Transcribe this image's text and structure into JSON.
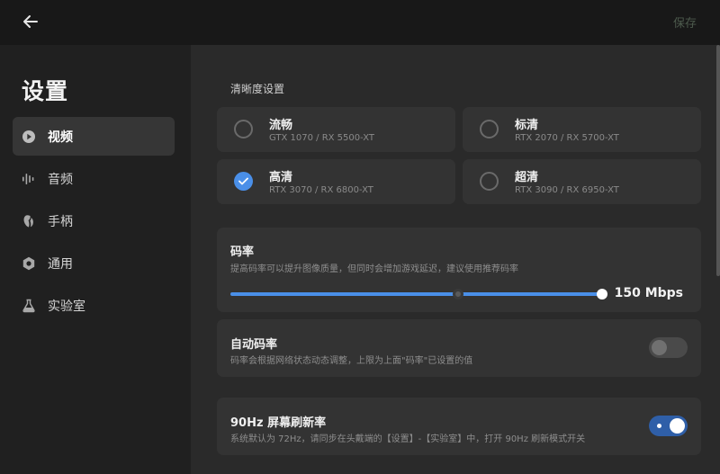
{
  "header": {
    "save_label": "保存",
    "back_icon": "arrow-left-icon"
  },
  "sidebar": {
    "title": "设置",
    "items": [
      {
        "label": "视频",
        "icon": "play-circle-icon",
        "active": true
      },
      {
        "label": "音频",
        "icon": "audio-bars-icon",
        "active": false
      },
      {
        "label": "手柄",
        "icon": "controller-icon",
        "active": false
      },
      {
        "label": "通用",
        "icon": "gear-icon",
        "active": false
      },
      {
        "label": "实验室",
        "icon": "flask-icon",
        "active": false
      }
    ]
  },
  "quality": {
    "section_title": "清晰度设置",
    "options": [
      {
        "name": "流畅",
        "sub": "GTX 1070 / RX 5500-XT",
        "selected": false
      },
      {
        "name": "标清",
        "sub": "RTX 2070 / RX 5700-XT",
        "selected": false
      },
      {
        "name": "高清",
        "sub": "RTX 3070 / RX 6800-XT",
        "selected": true
      },
      {
        "name": "超清",
        "sub": "RTX 3090 / RX 6950-XT",
        "selected": false
      }
    ]
  },
  "bitrate": {
    "title": "码率",
    "desc": "提高码率可以提升图像质量，但同时会增加游戏延迟，建议使用推荐码率",
    "value_label": "150 Mbps",
    "fill_fraction": 1.0
  },
  "auto_bitrate": {
    "title": "自动码率",
    "desc": "码率会根据网络状态动态调整，上限为上面\"码率\"已设置的值",
    "enabled": false
  },
  "refresh_90hz": {
    "title": "90Hz 屏幕刷新率",
    "desc": "系统默认为 72Hz，请同步在头戴端的【设置】-【实验室】中，打开 90Hz 刷新模式开关",
    "enabled": true
  },
  "colors": {
    "accent": "#4a8fe8",
    "toggle_on": "#2f5fa8",
    "card": "#333333",
    "sidebar": "#202020",
    "topbar": "#181818"
  }
}
